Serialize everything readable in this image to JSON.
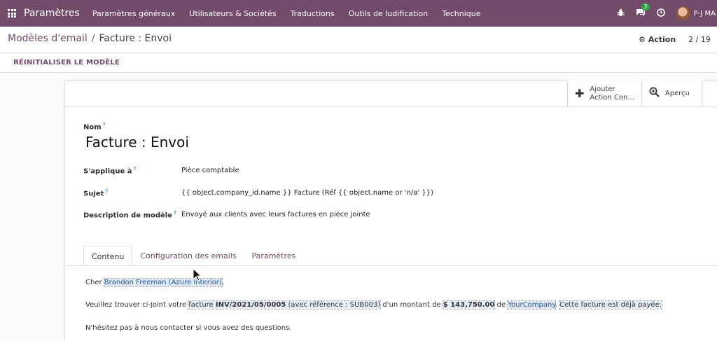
{
  "navbar": {
    "brand": "Paramètres",
    "items": [
      "Paramètres généraux",
      "Utilisateurs & Sociétés",
      "Traductions",
      "Outils de ludification",
      "Technique"
    ],
    "chat_badge": "3",
    "user_name": "P-J MA"
  },
  "breadcrumb": {
    "parent": "Modèles d'email",
    "separator": "/",
    "current": "Facture : Envoi"
  },
  "control": {
    "action_label": "Action",
    "pager": "2 / 19"
  },
  "statusbar": {
    "reset_label": "RÉINITIALISER LE MODÈLE"
  },
  "smart_buttons": {
    "add_action_line1": "Ajouter",
    "add_action_line2": "Action Con...",
    "preview_label": "Aperçu"
  },
  "form": {
    "name_label": "Nom",
    "help_mark": "?",
    "name_value": "Facture : Envoi",
    "applies_label": "S'applique à",
    "applies_value": "Pièce comptable",
    "subject_label": "Sujet",
    "subject_value": "{{ object.company_id.name }} Facture (Réf {{ object.name or 'n/a' }})",
    "description_label": "Description de modèle",
    "description_value": "Envoyé aux clients avec leurs factures en pièce jointe"
  },
  "tabs": [
    "Contenu",
    "Configuration des emails",
    "Paramètres"
  ],
  "content": {
    "greeting_prefix": "Cher ",
    "greeting_name": "Brandon Freeman (Azure Interior)",
    "greeting_suffix": ",",
    "line2_prefix": "Veuillez trouver ci-joint votre ",
    "line2_facture": "facture ",
    "line2_invoice": "INV/2021/05/0005",
    "line2_ref": " (avec référence : SUB003)",
    "line2_mid": " d'un montant de ",
    "line2_amount": "$ 143,750.00",
    "line2_de": " de ",
    "line2_company": "YourCompany",
    "line2_dot": ". ",
    "line2_paid": "Cette facture est déjà payée.",
    "line3": "N'hésitez pas à nous contacter si vous avez des questions."
  },
  "colors": {
    "brand": "#714B67",
    "badge": "#28a745",
    "help": "#3c9bd6"
  }
}
